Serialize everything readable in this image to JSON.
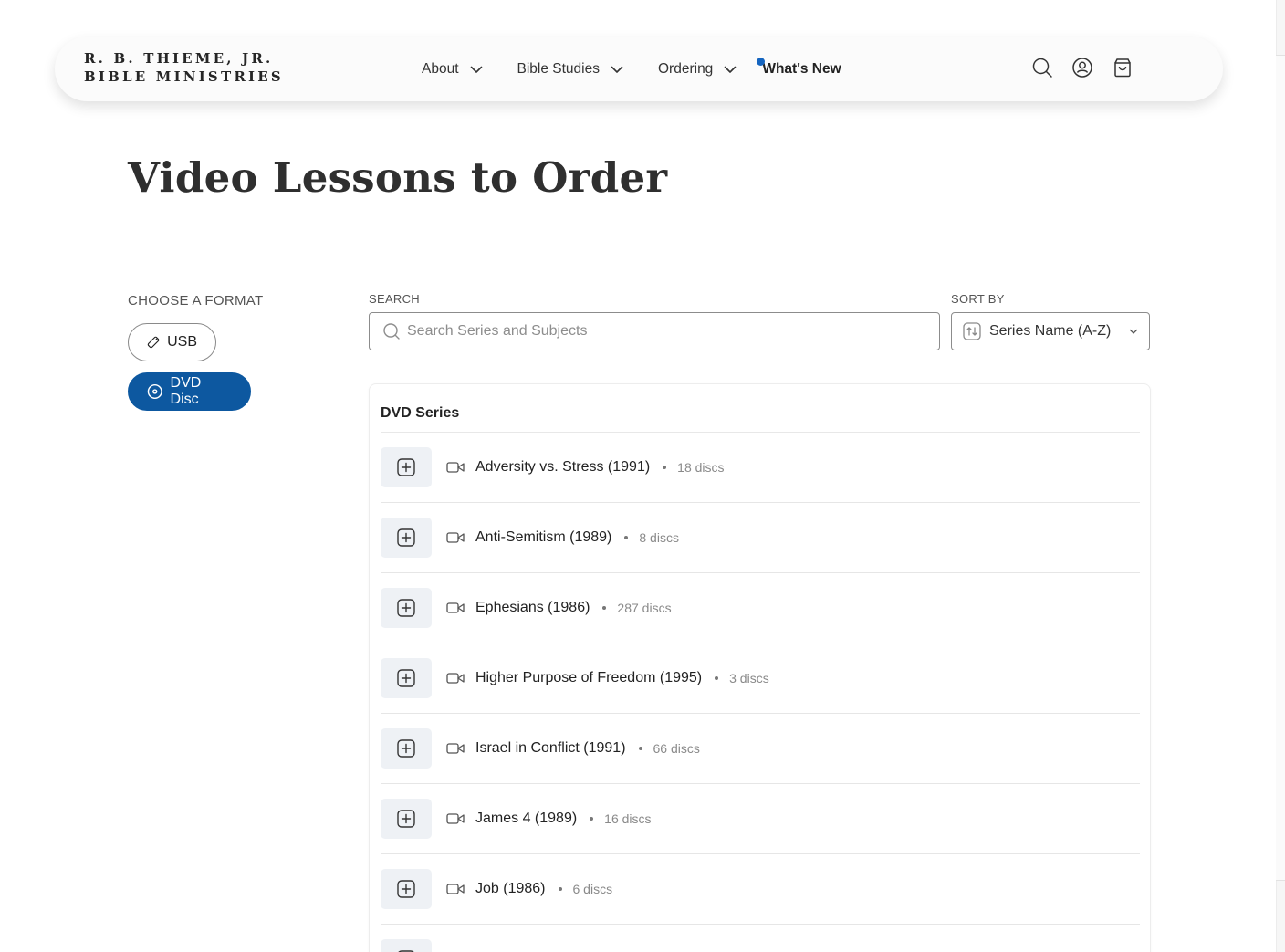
{
  "header": {
    "logo_line1": "R. B. THIEME, JR.",
    "logo_line2": "BIBLE MINISTRIES",
    "nav": [
      {
        "label": "About"
      },
      {
        "label": "Bible Studies"
      },
      {
        "label": "Ordering"
      }
    ],
    "whats_new": "What's New",
    "accent_color": "#1565c0",
    "icons": [
      "search-icon",
      "account-icon",
      "cart-icon"
    ]
  },
  "page_title": "Video Lessons to Order",
  "format": {
    "label": "CHOOSE A FORMAT",
    "options": [
      {
        "label": "USB",
        "icon": "usb-icon",
        "selected": false
      },
      {
        "label": "DVD Disc",
        "icon": "disc-icon",
        "selected": true
      }
    ],
    "selected_color": "#0d58a0"
  },
  "search": {
    "label": "SEARCH",
    "placeholder": "Search Series and Subjects",
    "value": ""
  },
  "sort": {
    "label": "SORT BY",
    "value": "Series Name (A-Z)"
  },
  "series_panel": {
    "title": "DVD Series",
    "items": [
      {
        "name": "Adversity vs. Stress (1991)",
        "discs": "18 discs"
      },
      {
        "name": "Anti-Semitism (1989)",
        "discs": "8 discs"
      },
      {
        "name": "Ephesians (1986)",
        "discs": "287 discs"
      },
      {
        "name": "Higher Purpose of Freedom (1995)",
        "discs": "3 discs"
      },
      {
        "name": "Israel in Conflict (1991)",
        "discs": "66 discs"
      },
      {
        "name": "James 4 (1989)",
        "discs": "16 discs"
      },
      {
        "name": "Job (1986)",
        "discs": "6 discs"
      }
    ]
  }
}
